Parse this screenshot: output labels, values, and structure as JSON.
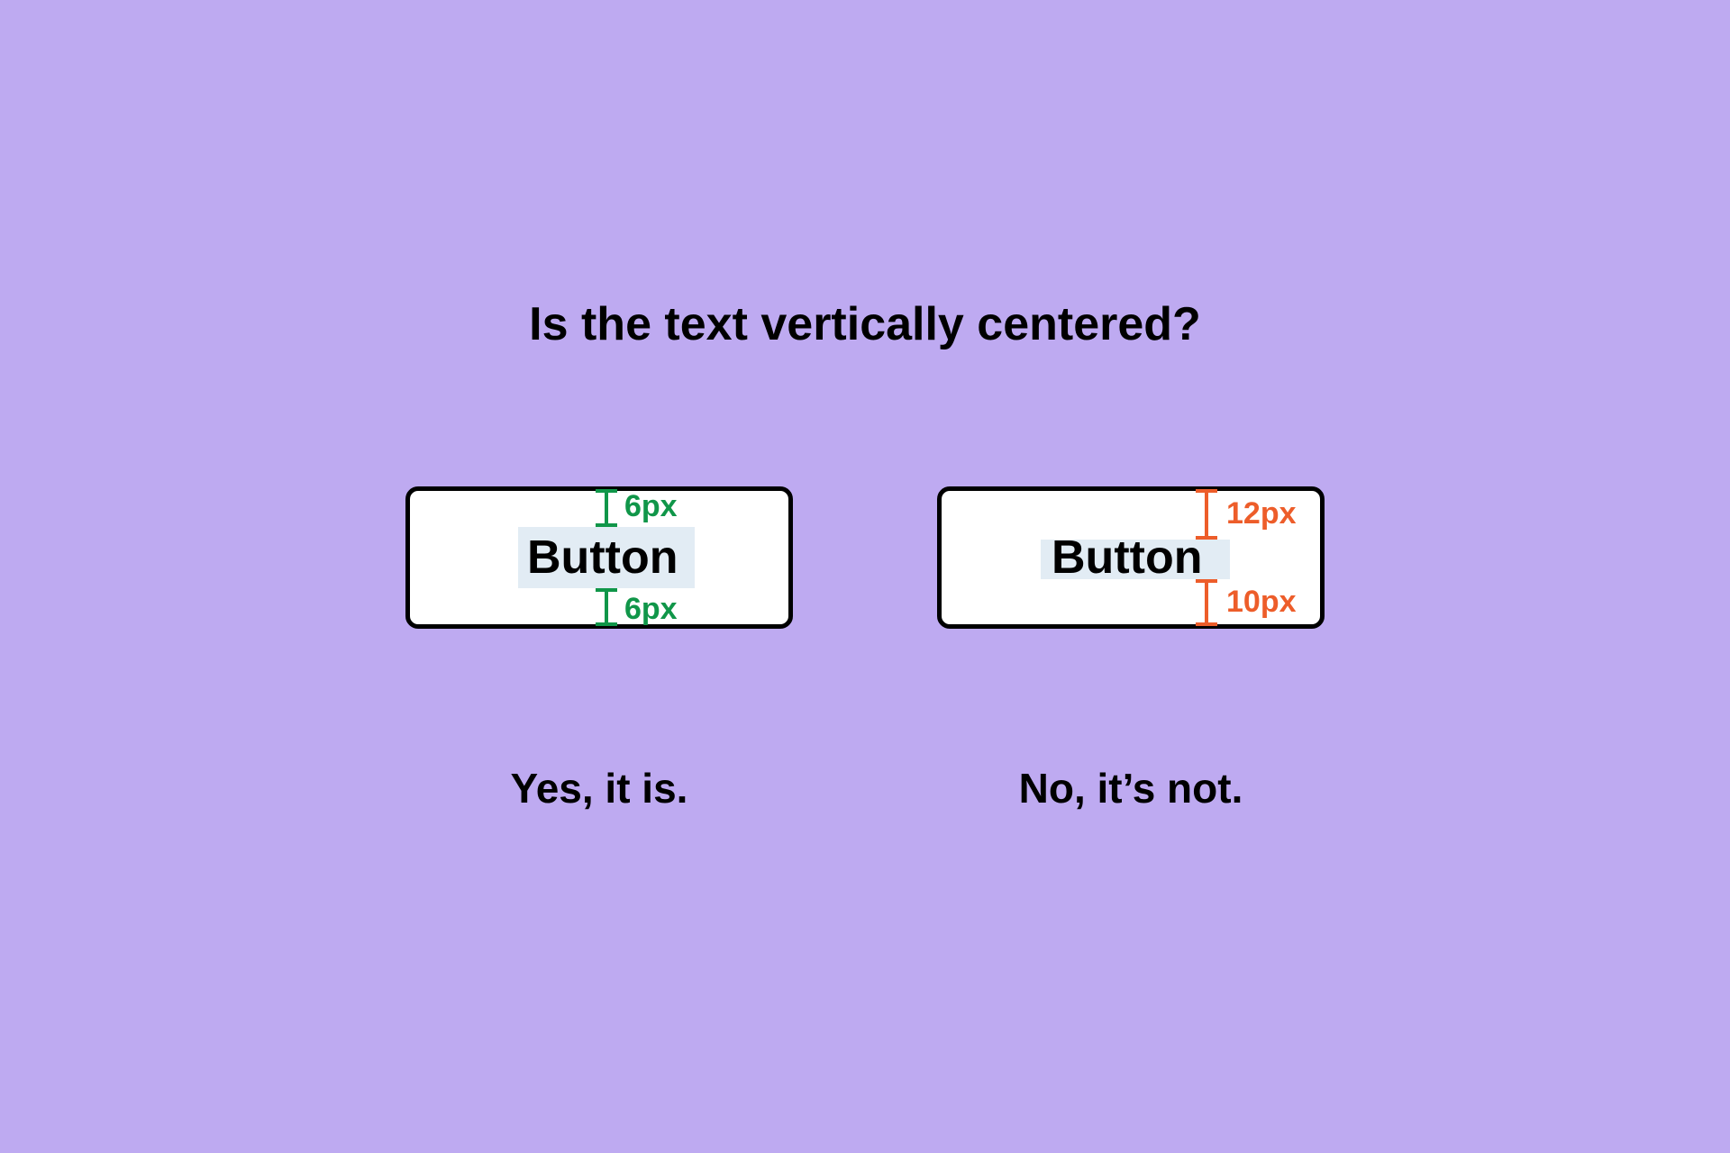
{
  "heading": "Is the text vertically centered?",
  "left": {
    "button_text": "Button",
    "top_px": "6px",
    "bottom_px": "6px",
    "caption": "Yes, it is.",
    "color": "#109649"
  },
  "right": {
    "button_text": "Button",
    "top_px": "12px",
    "bottom_px": "10px",
    "caption": "No, it’s not.",
    "color": "#ed5d2a"
  }
}
